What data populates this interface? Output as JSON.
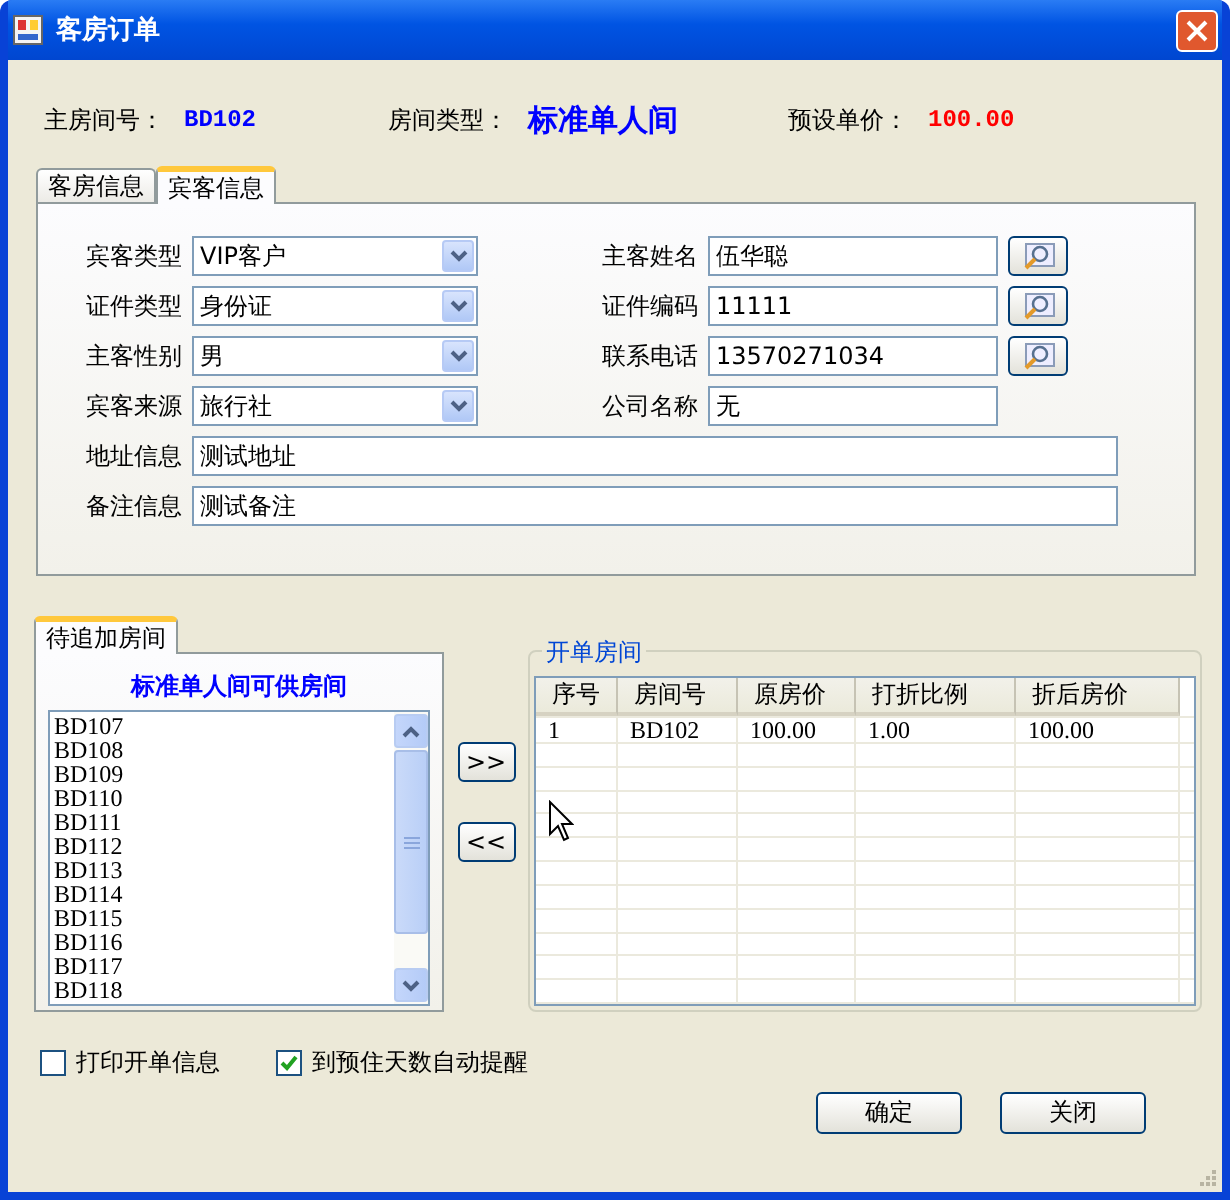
{
  "window": {
    "title": "客房订单"
  },
  "header": [
    {
      "label": "主房间号：",
      "value": "BD102",
      "kind": "code",
      "color": "#0000ff"
    },
    {
      "label": "房间类型：",
      "value": "标准单人间",
      "kind": "big",
      "color": "#0000ff"
    },
    {
      "label": "预设单价：",
      "value": "100.00",
      "kind": "code",
      "color": "#ff0000"
    }
  ],
  "tabs": [
    {
      "label": "客房信息",
      "selected": false
    },
    {
      "label": "宾客信息",
      "selected": true
    }
  ],
  "guest_form": {
    "rows": [
      {
        "left": {
          "label": "宾客类型",
          "value": "VIP客户"
        },
        "right": {
          "label": "主客姓名",
          "value": "伍华聪",
          "kind": "lookup"
        }
      },
      {
        "left": {
          "label": "证件类型",
          "value": "身份证"
        },
        "right": {
          "label": "证件编码",
          "value": "11111",
          "kind": "lookup"
        }
      },
      {
        "left": {
          "label": "主客性别",
          "value": "男"
        },
        "right": {
          "label": "联系电话",
          "value": "13570271034",
          "kind": "lookup"
        }
      },
      {
        "left": {
          "label": "宾客来源",
          "value": "旅行社"
        },
        "right": {
          "label": "公司名称",
          "value": "无",
          "kind": "text"
        }
      }
    ],
    "wide": [
      {
        "label": "地址信息",
        "value": "测试地址"
      },
      {
        "label": "备注信息",
        "value": "测试备注"
      }
    ]
  },
  "available": {
    "tabs": [
      {
        "label": "待追加房间",
        "selected": true
      }
    ],
    "title": "标准单人间可供房间",
    "items": [
      "BD107",
      "BD108",
      "BD109",
      "BD110",
      "BD111",
      "BD112",
      "BD113",
      "BD114",
      "BD115",
      "BD116",
      "BD117",
      "BD118"
    ]
  },
  "move_buttons": [
    ">>",
    "<<"
  ],
  "order_rooms": {
    "title": "开单房间",
    "columns": [
      "序号",
      "房间号",
      "原房价",
      "打折比例",
      "折后房价"
    ],
    "rows": [
      [
        "1",
        "BD102",
        "100.00",
        "1.00",
        "100.00"
      ]
    ]
  },
  "options": [
    {
      "label": "打印开单信息",
      "checked": false
    },
    {
      "label": "到预住天数自动提醒",
      "checked": true
    }
  ],
  "buttons": [
    "确定",
    "关闭"
  ]
}
